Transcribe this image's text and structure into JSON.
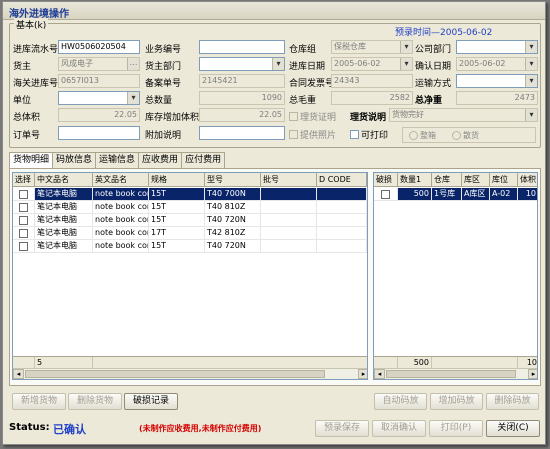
{
  "window": {
    "title": "海外进境操作"
  },
  "basic": {
    "legend": "基本(k)",
    "pre_time_label": "预录时间",
    "pre_time": "2005-06-02"
  },
  "fields": {
    "entry_no": {
      "label": "进库流水号",
      "value": "HW0506020504"
    },
    "biz_no": {
      "label": "业务编号",
      "value": ""
    },
    "warehouse_group": {
      "label": "仓库组",
      "value": "保税仓库"
    },
    "company_dept": {
      "label": "公司部门",
      "value": ""
    },
    "owner": {
      "label": "货主",
      "value": "风成电子"
    },
    "owner_dept": {
      "label": "货主部门",
      "value": ""
    },
    "entry_date": {
      "label": "进库日期",
      "value": "2005-06-02"
    },
    "confirm_date": {
      "label": "确认日期",
      "value": "2005-06-02"
    },
    "customs_entry_no": {
      "label": "海关进库号",
      "value": "0657I013"
    },
    "record_no": {
      "label": "备案单号",
      "value": "2145421"
    },
    "contract_invoice": {
      "label": "合同发票号",
      "value": "24343"
    },
    "transport_mode": {
      "label": "运输方式",
      "value": ""
    },
    "unit": {
      "label": "单位",
      "value": ""
    },
    "total_qty": {
      "label": "总数量",
      "value": "1090"
    },
    "total_gross": {
      "label": "总毛重",
      "value": "2582"
    },
    "total_net": {
      "label": "总净重",
      "value": "2473"
    },
    "total_volume": {
      "label": "总体积",
      "value": "22.05"
    },
    "stock_added_volume": {
      "label": "库存增加体积",
      "value": "22.05"
    },
    "tally_cert": {
      "label": "理货证明"
    },
    "tally_desc": {
      "label": "理货说明",
      "value": "货物完好"
    },
    "order_no": {
      "label": "订单号",
      "value": ""
    },
    "extra_note": {
      "label": "附加说明",
      "value": ""
    },
    "photo_provided": {
      "label": "提供照片"
    },
    "printable": {
      "label": "可打印"
    },
    "radio_whole": "整箱",
    "radio_loose": "散货"
  },
  "tabs": [
    "货物明细",
    "码放信息",
    "运输信息",
    "应收费用",
    "应付费用"
  ],
  "goods_grid": {
    "headers": [
      "选择",
      "中文品名",
      "英文品名",
      "规格",
      "型号",
      "批号",
      "D CODE"
    ],
    "rows": [
      {
        "cn": "笔记本电脑",
        "en": "note book comp",
        "spec": "15T",
        "model": "T40 700N",
        "batch": "",
        "dcode": ""
      },
      {
        "cn": "笔记本电脑",
        "en": "note book comp",
        "spec": "15T",
        "model": "T40 810Z",
        "batch": "",
        "dcode": ""
      },
      {
        "cn": "笔记本电脑",
        "en": "note book comp",
        "spec": "15T",
        "model": "T40 720N",
        "batch": "",
        "dcode": ""
      },
      {
        "cn": "笔记本电脑",
        "en": "note book comp",
        "spec": "17T",
        "model": "T42 810Z",
        "batch": "",
        "dcode": ""
      },
      {
        "cn": "笔记本电脑",
        "en": "note book comp",
        "spec": "15T",
        "model": "T40 720N",
        "batch": "",
        "dcode": ""
      }
    ],
    "footer_count": "5"
  },
  "loss_grid": {
    "headers": [
      "破损",
      "数量1",
      "仓库",
      "库区",
      "库位",
      "体积"
    ],
    "rows": [
      {
        "qty": "500",
        "wh": "1号库",
        "zone": "A库区",
        "loc": "A-02",
        "vol": "10"
      }
    ],
    "footer_qty": "500",
    "footer_vol": "10"
  },
  "buttons": {
    "add_goods": "新增货物",
    "delete_goods": "删除货物",
    "damage_record": "破损记录",
    "auto_stack": "自动码放",
    "add_stack": "增加码放",
    "delete_stack": "删除码放",
    "pre_save": "预录保存",
    "cancel_confirm": "取消确认",
    "print": "打印(P)",
    "close": "关闭(C)"
  },
  "status": {
    "label": "Status:",
    "value": "已确认",
    "note": "(未制作应收费用,未制作应付费用)"
  }
}
